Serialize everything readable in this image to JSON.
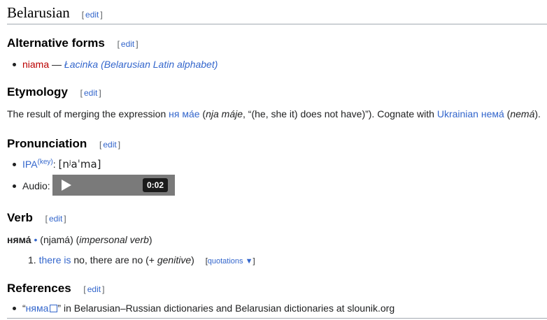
{
  "language_heading": {
    "title": "Belarusian",
    "edit": "edit"
  },
  "alternative_forms": {
    "heading": "Alternative forms",
    "edit": "edit",
    "item": {
      "word": "niama",
      "dash": " — ",
      "script": "Łacinka (Belarusian Latin alphabet)"
    }
  },
  "etymology": {
    "heading": "Etymology",
    "edit": "edit",
    "text_1": "The result of merging the expression ",
    "link_1": "ня ма́е",
    "text_2": " (",
    "translit_1": "nja máje",
    "text_3": ", “(he, she it) does not have)”). Cognate with ",
    "link_2": "Ukrainian",
    "text_4": " ",
    "link_3": "нема́",
    "text_5": " (",
    "translit_2": "nemá",
    "text_6": ")."
  },
  "pronunciation": {
    "heading": "Pronunciation",
    "edit": "edit",
    "ipa_label": "IPA",
    "ipa_key": "(key)",
    "ipa_sep": ": ",
    "ipa_value": "[nʲaˈma]",
    "audio_label": "Audio:",
    "audio_time": "0:02"
  },
  "verb": {
    "heading": "Verb",
    "edit": "edit",
    "headword": "няма́",
    "dot": " •",
    "translit": " (njamá) (",
    "type": "impersonal verb",
    "close": ")",
    "definition": {
      "num": "1.",
      "link": "there is",
      "text": " no, there are no (+ ",
      "case": "genitive",
      "close": ")",
      "quotations": "quotations ▼"
    }
  },
  "references": {
    "heading": "References",
    "edit": "edit",
    "quote_open": "“",
    "link": "няма",
    "text": "” in Belarusian–Russian dictionaries and Belarusian dictionaries at slounik.org"
  }
}
